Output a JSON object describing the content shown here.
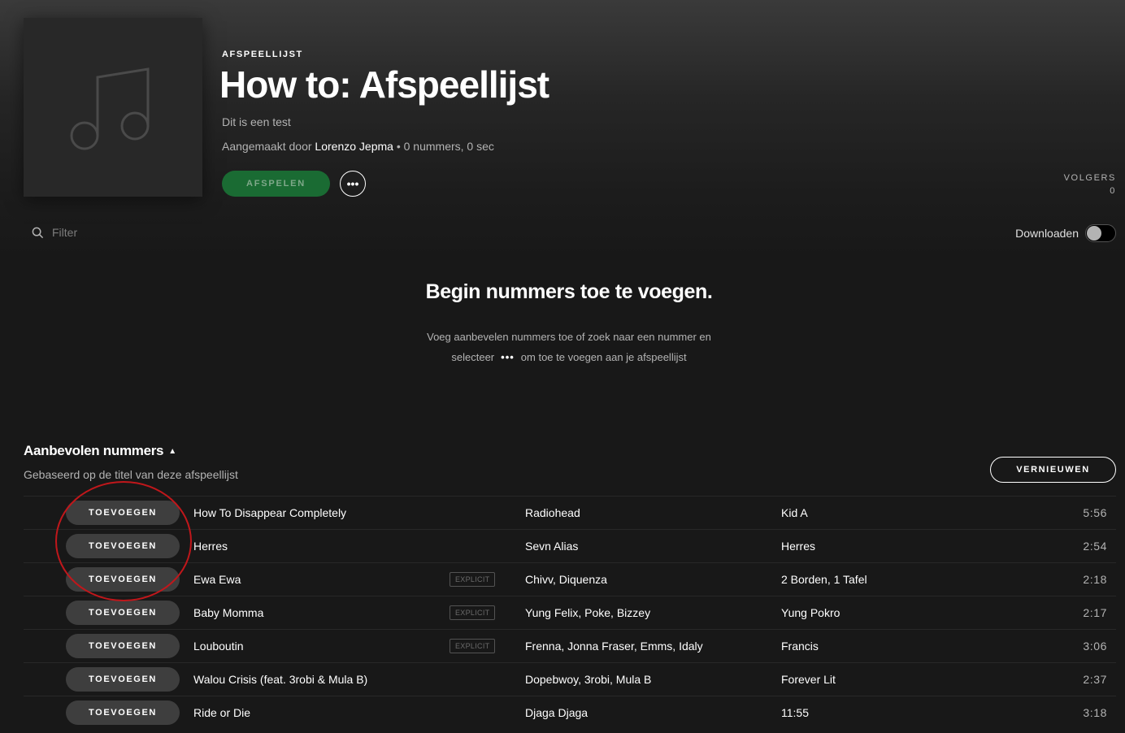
{
  "header": {
    "type_label": "AFSPEELLIJST",
    "title": "How to: Afspeellijst",
    "description": "Dit is een test",
    "created_by_label": "Aangemaakt door",
    "owner": "Lorenzo Jepma",
    "stats": "• 0 nummers, 0 sec",
    "play_label": "AFSPELEN",
    "more_label": "•••",
    "followers_label": "VOLGERS",
    "followers_count": "0"
  },
  "filter": {
    "placeholder": "Filter"
  },
  "download": {
    "label": "Downloaden",
    "enabled": false
  },
  "empty_state": {
    "title": "Begin nummers toe te voegen.",
    "line1": "Voeg aanbevelen nummers toe of zoek naar een nummer en",
    "line2_before": "selecteer",
    "dots": "•••",
    "line2_after": "om toe te voegen aan je afspeellijst"
  },
  "recommended": {
    "title": "Aanbevolen nummers",
    "subtitle": "Gebaseerd op de titel van deze afspeellijst",
    "refresh_label": "VERNIEUWEN",
    "add_label": "TOEVOEGEN",
    "explicit_label": "EXPLICIT",
    "tracks": [
      {
        "title": "How To Disappear Completely",
        "explicit": false,
        "artist": "Radiohead",
        "album": "Kid A",
        "duration": "5:56"
      },
      {
        "title": "Herres",
        "explicit": false,
        "artist": "Sevn Alias",
        "album": "Herres",
        "duration": "2:54"
      },
      {
        "title": "Ewa Ewa",
        "explicit": true,
        "artist": "Chivv, Diquenza",
        "album": "2 Borden, 1 Tafel",
        "duration": "2:18"
      },
      {
        "title": "Baby Momma",
        "explicit": true,
        "artist": "Yung Felix, Poke, Bizzey",
        "album": "Yung Pokro",
        "duration": "2:17"
      },
      {
        "title": "Louboutin",
        "explicit": true,
        "artist": "Frenna, Jonna Fraser, Emms, Idaly",
        "album": "Francis",
        "duration": "3:06"
      },
      {
        "title": "Walou Crisis (feat. 3robi & Mula B)",
        "explicit": false,
        "artist": "Dopebwoy, 3robi, Mula B",
        "album": "Forever Lit",
        "duration": "2:37"
      },
      {
        "title": "Ride or Die",
        "explicit": false,
        "artist": "Djaga Djaga",
        "album": "11:55",
        "duration": "3:18"
      }
    ]
  },
  "colors": {
    "accent_green": "#1a6b33",
    "annotation_red": "#c0171b",
    "background": "#181818"
  }
}
